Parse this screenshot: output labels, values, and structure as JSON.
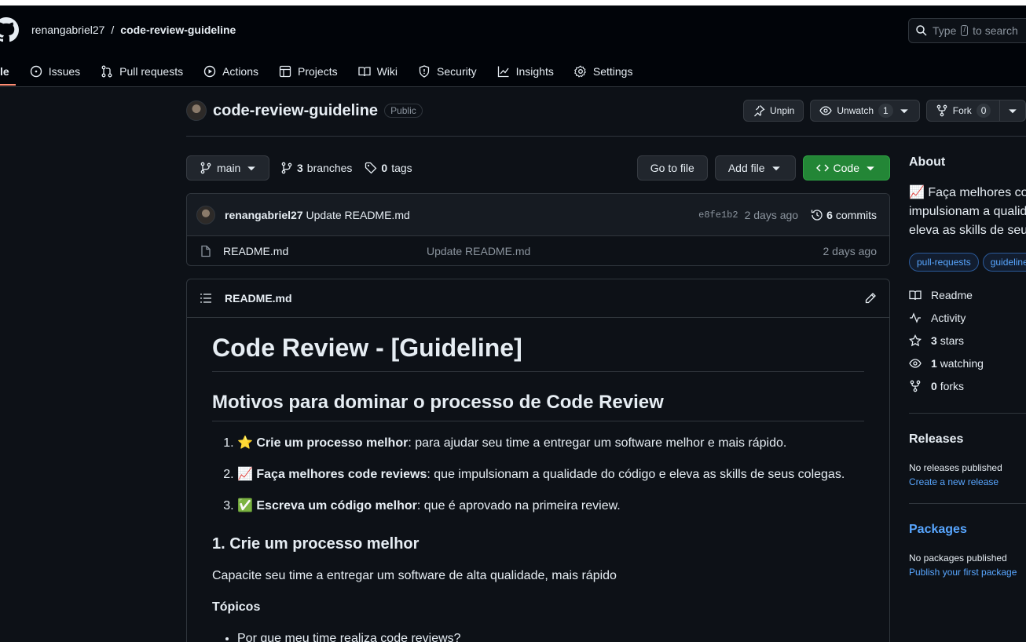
{
  "header": {
    "owner": "renangabriel27",
    "separator": "/",
    "repo": "code-review-guideline",
    "search_prefix": "Type",
    "search_key": "/",
    "search_suffix": "to search"
  },
  "tabs": [
    {
      "label": "le"
    },
    {
      "label": "Issues"
    },
    {
      "label": "Pull requests"
    },
    {
      "label": "Actions"
    },
    {
      "label": "Projects"
    },
    {
      "label": "Wiki"
    },
    {
      "label": "Security"
    },
    {
      "label": "Insights"
    },
    {
      "label": "Settings"
    }
  ],
  "repo_header": {
    "name": "code-review-guideline",
    "visibility": "Public",
    "unpin": "Unpin",
    "unwatch": "Unwatch",
    "watch_count": "1",
    "fork": "Fork",
    "fork_count": "0"
  },
  "filebar": {
    "branch": "main",
    "branches_count": "3",
    "branches_label": "branches",
    "tags_count": "0",
    "tags_label": "tags",
    "goto_file": "Go to file",
    "add_file": "Add file",
    "code": "Code"
  },
  "last_commit": {
    "author": "renangabriel27",
    "message": "Update README.md",
    "sha": "e8fe1b2",
    "date": "2 days ago",
    "commits_count": "6",
    "commits_label": "commits"
  },
  "files": [
    {
      "name": "README.md",
      "message": "Update README.md",
      "date": "2 days ago"
    }
  ],
  "readme": {
    "filename": "README.md",
    "h1": "Code Review - [Guideline]",
    "h2": "Motivos para dominar o processo de Code Review",
    "items": [
      {
        "emoji": "⭐",
        "bold": "Crie um processo melhor",
        "text": ": para ajudar seu time a entregar um software melhor e mais rápido."
      },
      {
        "emoji": "📈",
        "bold": "Faça melhores code reviews",
        "text": ": que impulsionam a qualidade do código e eleva as skills de seus colegas."
      },
      {
        "emoji": "✅",
        "bold": "Escreva um código melhor",
        "text": ": que é aprovado na primeira review."
      }
    ],
    "h3": "1. Crie um processo melhor",
    "p1": "Capacite seu time a entregar um software de alta qualidade, mais rápido",
    "topicos": "Tópicos",
    "bullet1": "Por que meu time realiza code reviews?"
  },
  "sidebar": {
    "about_title": "About",
    "about_lines": [
      "📈 Faça melhores co",
      "impulsionam a qualid",
      "eleva as skills de seu"
    ],
    "topics": [
      "pull-requests",
      "guideline"
    ],
    "readme": "Readme",
    "activity": "Activity",
    "stars_count": "3",
    "stars_label": "stars",
    "watching_count": "1",
    "watching_label": "watching",
    "forks_count": "0",
    "forks_label": "forks",
    "releases_title": "Releases",
    "no_releases": "No releases published",
    "create_release": "Create a new release",
    "packages_title": "Packages",
    "no_packages": "No packages published",
    "publish_package": "Publish your first package"
  },
  "colors": {
    "background": "#0d1117",
    "header": "#010409",
    "accent_green": "#238636",
    "link_blue": "#58a6ff",
    "tab_underline": "#fd8c73"
  }
}
